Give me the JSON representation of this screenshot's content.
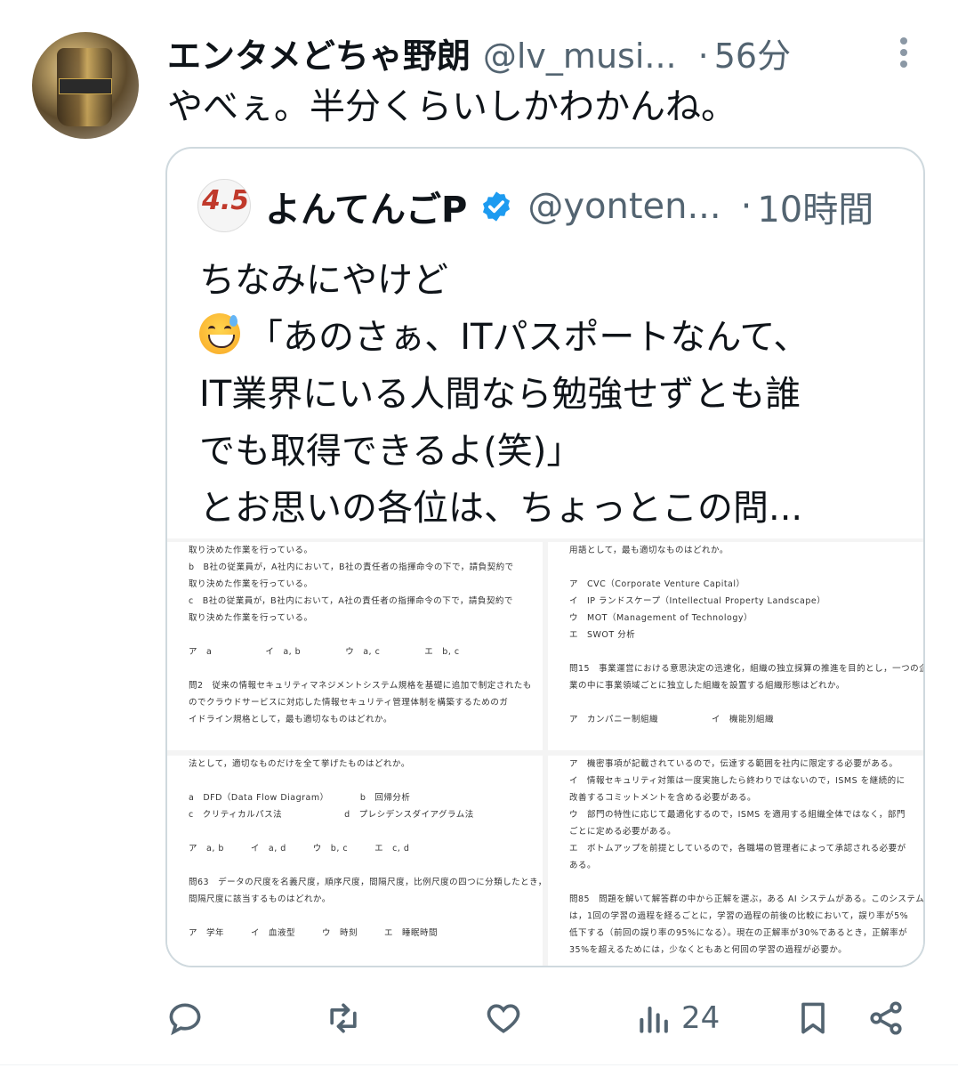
{
  "tweet": {
    "author_name": "エンタメどちゃ野朗",
    "author_handle": "@lv_musi...",
    "separator": "·",
    "time": "56分",
    "text": "やべぇ。半分くらいしかわかんね。"
  },
  "quoted": {
    "avatar_text": "4.5",
    "author_name": "よんてんごP",
    "author_handle": "@yonten...",
    "separator": "·",
    "time": "10時間",
    "lines": [
      "ちなみにやけど",
      "「あのさぁ、ITパスポートなんて、",
      "IT業界にいる人間なら勉強せずとも誰",
      "でも取得できるよ(笑)」",
      "とお思いの各位は、ちょっとこの問..."
    ],
    "scan1": [
      "取り決めた作業を行っている。",
      "b　B社の従業員が，A社内において，B社の責任者の指揮命令の下で，請負契約で",
      "取り決めた作業を行っている。",
      "c　B社の従業員が，B社内において，A社の責任者の指揮命令の下で，請負契約で",
      "取り決めた作業を行っている。",
      "",
      "ア　a　　　　　　イ　a, b　　　　　ウ　a, c　　　　　エ　b, c",
      "",
      "問2　従来の情報セキュリティマネジメントシステム規格を基礎に追加で制定されたも",
      "のでクラウドサービスに対応した情報セキュリティ管理体制を構築するためのガ",
      "イドライン規格として，最も適切なものはどれか。"
    ],
    "scan2": [
      "用語として，最も適切なものはどれか。",
      "",
      "ア　CVC（Corporate Venture Capital）",
      "イ　IP ランドスケープ（Intellectual Property Landscape）",
      "ウ　MOT（Management of Technology）",
      "エ　SWOT 分析",
      "",
      "問15　事業運営における意思決定の迅速化，組織の独立採算の推進を目的とし，一つの企",
      "業の中に事業領域ごとに独立した組織を設置する組織形態はどれか。",
      "",
      "ア　カンパニー制組織　　　　　　イ　機能別組織"
    ],
    "scan3": [
      "法として，適切なものだけを全て挙げたものはどれか。",
      "",
      "a　DFD（Data Flow Diagram）　　　　b　回帰分析",
      "c　クリティカルパス法　　　　　　　d　プレシデンスダイアグラム法",
      "",
      "ア　a, b　　　イ　a, d　　　ウ　b, c　　　エ　c, d",
      "",
      "問63　データの尺度を名義尺度，順序尺度，間隔尺度，比例尺度の四つに分類したとき，",
      "間隔尺度に該当するものはどれか。",
      "",
      "ア　学年　　　イ　血液型　　　ウ　時刻　　　エ　睡眠時間"
    ],
    "scan4": [
      "ア　機密事項が記載されているので，伝達する範囲を社内に限定する必要がある。",
      "イ　情報セキュリティ対策は一度実施したら終わりではないので，ISMS を継続的に",
      "改善するコミットメントを含める必要がある。",
      "ウ　部門の特性に応じて最適化するので，ISMS を適用する組織全体ではなく，部門",
      "ごとに定める必要がある。",
      "エ　ボトムアップを前提としているので，各職場の管理者によって承認される必要が",
      "ある。",
      "",
      "問85　問題を解いて解答群の中から正解を選ぶ，ある AI システムがある。このシステム",
      "は，1回の学習の過程を経るごとに，学習の過程の前後の比較において，誤り率が5%",
      "低下する（前回の誤り率の95%になる）。現在の正解率が30%であるとき，正解率が",
      "35%を超えるためには，少なくともあと何回の学習の過程が必要か。"
    ]
  },
  "actions": {
    "views_count": "24"
  }
}
